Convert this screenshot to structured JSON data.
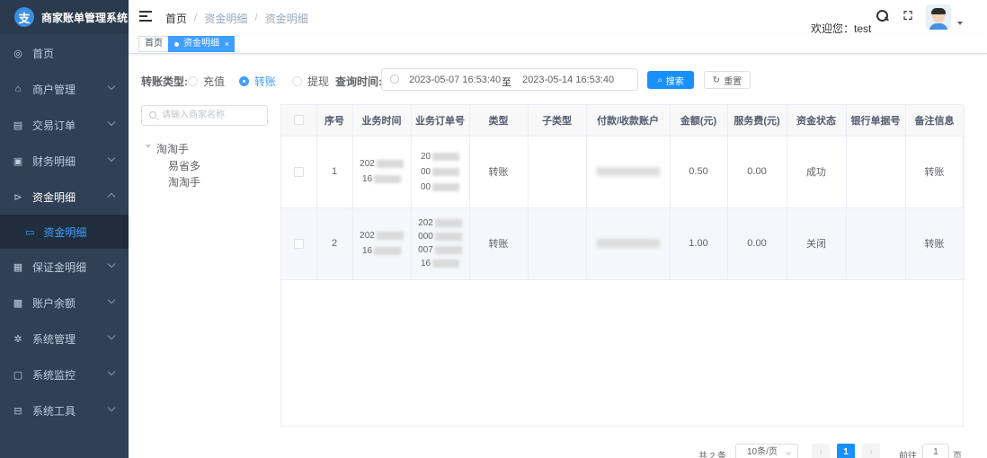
{
  "app": {
    "title": "商家账单管理系统",
    "logo_letter": "支"
  },
  "sidebar": {
    "items": [
      {
        "label": "首页",
        "icon": "dashboard-icon",
        "expandable": false
      },
      {
        "label": "商户管理",
        "icon": "shop-icon",
        "expandable": true
      },
      {
        "label": "交易订单",
        "icon": "table-icon",
        "expandable": true
      },
      {
        "label": "财务明细",
        "icon": "finance-icon",
        "expandable": true
      },
      {
        "label": "资金明细",
        "icon": "fund-icon",
        "expandable": true,
        "expanded": true
      },
      {
        "label": "保证金明细",
        "icon": "deposit-icon",
        "expandable": true
      },
      {
        "label": "账户余额",
        "icon": "balance-icon",
        "expandable": true
      },
      {
        "label": "系统管理",
        "icon": "gear-icon",
        "expandable": true
      },
      {
        "label": "系统监控",
        "icon": "monitor-icon",
        "expandable": true
      },
      {
        "label": "系统工具",
        "icon": "tool-icon",
        "expandable": true
      }
    ],
    "active_sub": {
      "label": "资金明细",
      "icon": "list-icon"
    }
  },
  "navbar": {
    "breadcrumb": [
      "首页",
      "/",
      "资金明细",
      "/",
      "资金明细"
    ],
    "welcome": "欢迎您：test"
  },
  "tags": {
    "home": "首页",
    "active": "资金明细",
    "close": "×"
  },
  "filter": {
    "type_label": "转账类型:",
    "options": [
      {
        "label": "充值",
        "checked": false
      },
      {
        "label": "转账",
        "checked": true
      },
      {
        "label": "提现",
        "checked": false
      }
    ],
    "time_label": "查询时间:",
    "start": "2023-05-07 16:53:40",
    "range_sep": "至",
    "end": "2023-05-14 16:53:40",
    "search_button": "搜索",
    "reset_button": "重置"
  },
  "tree": {
    "search_placeholder": "请输入商家名称",
    "root": "淘淘手",
    "children": [
      "易省多",
      "淘淘手"
    ]
  },
  "table": {
    "columns": [
      "",
      "序号",
      "业务时间",
      "业务订单号",
      "类型",
      "子类型",
      "付款/收款账户",
      "金额(元)",
      "服务费(元)",
      "资金状态",
      "银行单据号",
      "备注信息"
    ],
    "rows": [
      {
        "index": "1",
        "time": [
          "202",
          "16"
        ],
        "order": [
          "20",
          "00",
          "00"
        ],
        "type": "转账",
        "subtype": "",
        "amount": "0.50",
        "fee": "0.00",
        "status": "成功",
        "bank_no": "",
        "remark": "转账"
      },
      {
        "index": "2",
        "time": [
          "202",
          "16"
        ],
        "order": [
          "202",
          "000",
          "007",
          "16"
        ],
        "type": "转账",
        "subtype": "",
        "amount": "1.00",
        "fee": "0.00",
        "status": "关闭",
        "bank_no": "",
        "remark": "转账"
      }
    ]
  },
  "pagination": {
    "total": "共 2 条",
    "page_size": "10条/页",
    "current": "1",
    "goto_label": "前往",
    "goto_value": "1",
    "page_suffix": "页"
  },
  "colors": {
    "sidebar_bg": "#304156",
    "primary": "#1890ff",
    "active_text": "#409eff"
  }
}
